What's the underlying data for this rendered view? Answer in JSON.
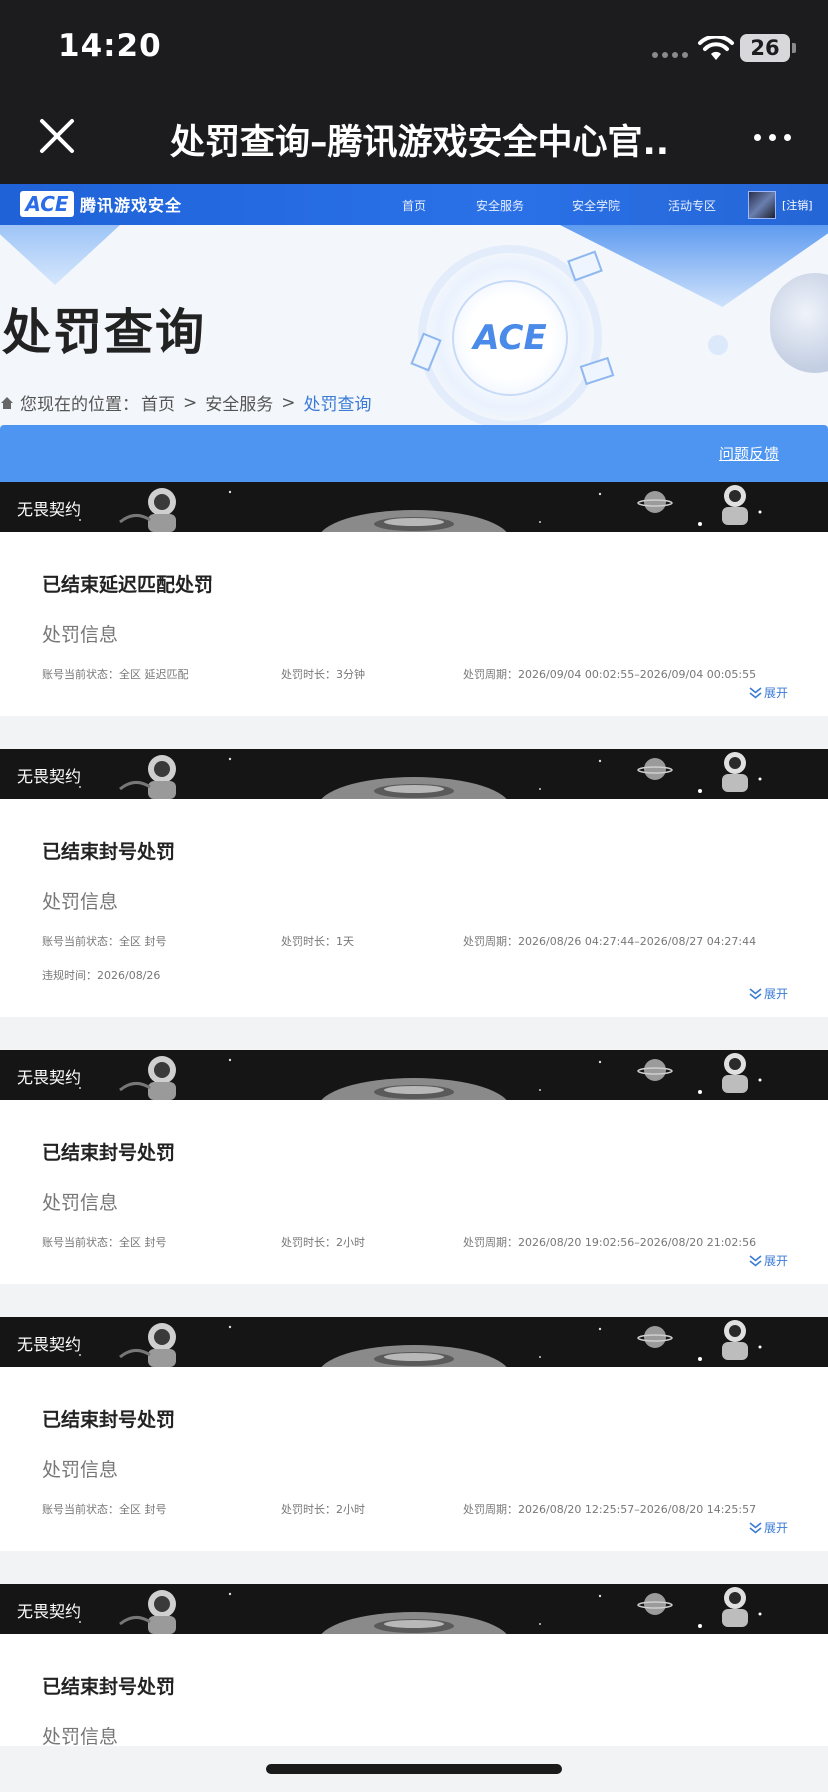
{
  "status_bar": {
    "time": "14:20",
    "battery": "26"
  },
  "nav": {
    "title": "处罚查询–腾讯游戏安全中心官..."
  },
  "site_header": {
    "logo_mark": "ACE",
    "logo_text": "腾讯游戏安全",
    "links": [
      "首页",
      "安全服务",
      "安全学院",
      "活动专区"
    ],
    "logout": "[注销]"
  },
  "hero": {
    "logo": "ACE",
    "title": "处罚查询",
    "breadcrumb": {
      "prefix": "您现在的位置：",
      "home": "首页",
      "sep": ">",
      "service": "安全服务",
      "current": "处罚查询"
    }
  },
  "feedback": {
    "label": "问题反馈"
  },
  "labels": {
    "status": "账号当前状态：",
    "duration": "处罚时长：",
    "period": "处罚周期：",
    "violation_time": "违规时间：",
    "expand": "展开",
    "info": "处罚信息"
  },
  "records": [
    {
      "game": "无畏契约",
      "title": "已结束延迟匹配处罚",
      "status": "全区 延迟匹配",
      "duration": "3分钟",
      "period": "2026/09/04 00:02:55–2026/09/04 00:05:55",
      "violation_time": ""
    },
    {
      "game": "无畏契约",
      "title": "已结束封号处罚",
      "status": "全区 封号",
      "duration": "1天",
      "period": "2026/08/26 04:27:44–2026/08/27 04:27:44",
      "violation_time": "2026/08/26"
    },
    {
      "game": "无畏契约",
      "title": "已结束封号处罚",
      "status": "全区 封号",
      "duration": "2小时",
      "period": "2026/08/20 19:02:56–2026/08/20 21:02:56",
      "violation_time": ""
    },
    {
      "game": "无畏契约",
      "title": "已结束封号处罚",
      "status": "全区 封号",
      "duration": "2小时",
      "period": "2026/08/20 12:25:57–2026/08/20 14:25:57",
      "violation_time": ""
    },
    {
      "game": "无畏契约",
      "title": "已结束封号处罚",
      "status": "",
      "duration": "",
      "period": "",
      "violation_time": ""
    }
  ]
}
